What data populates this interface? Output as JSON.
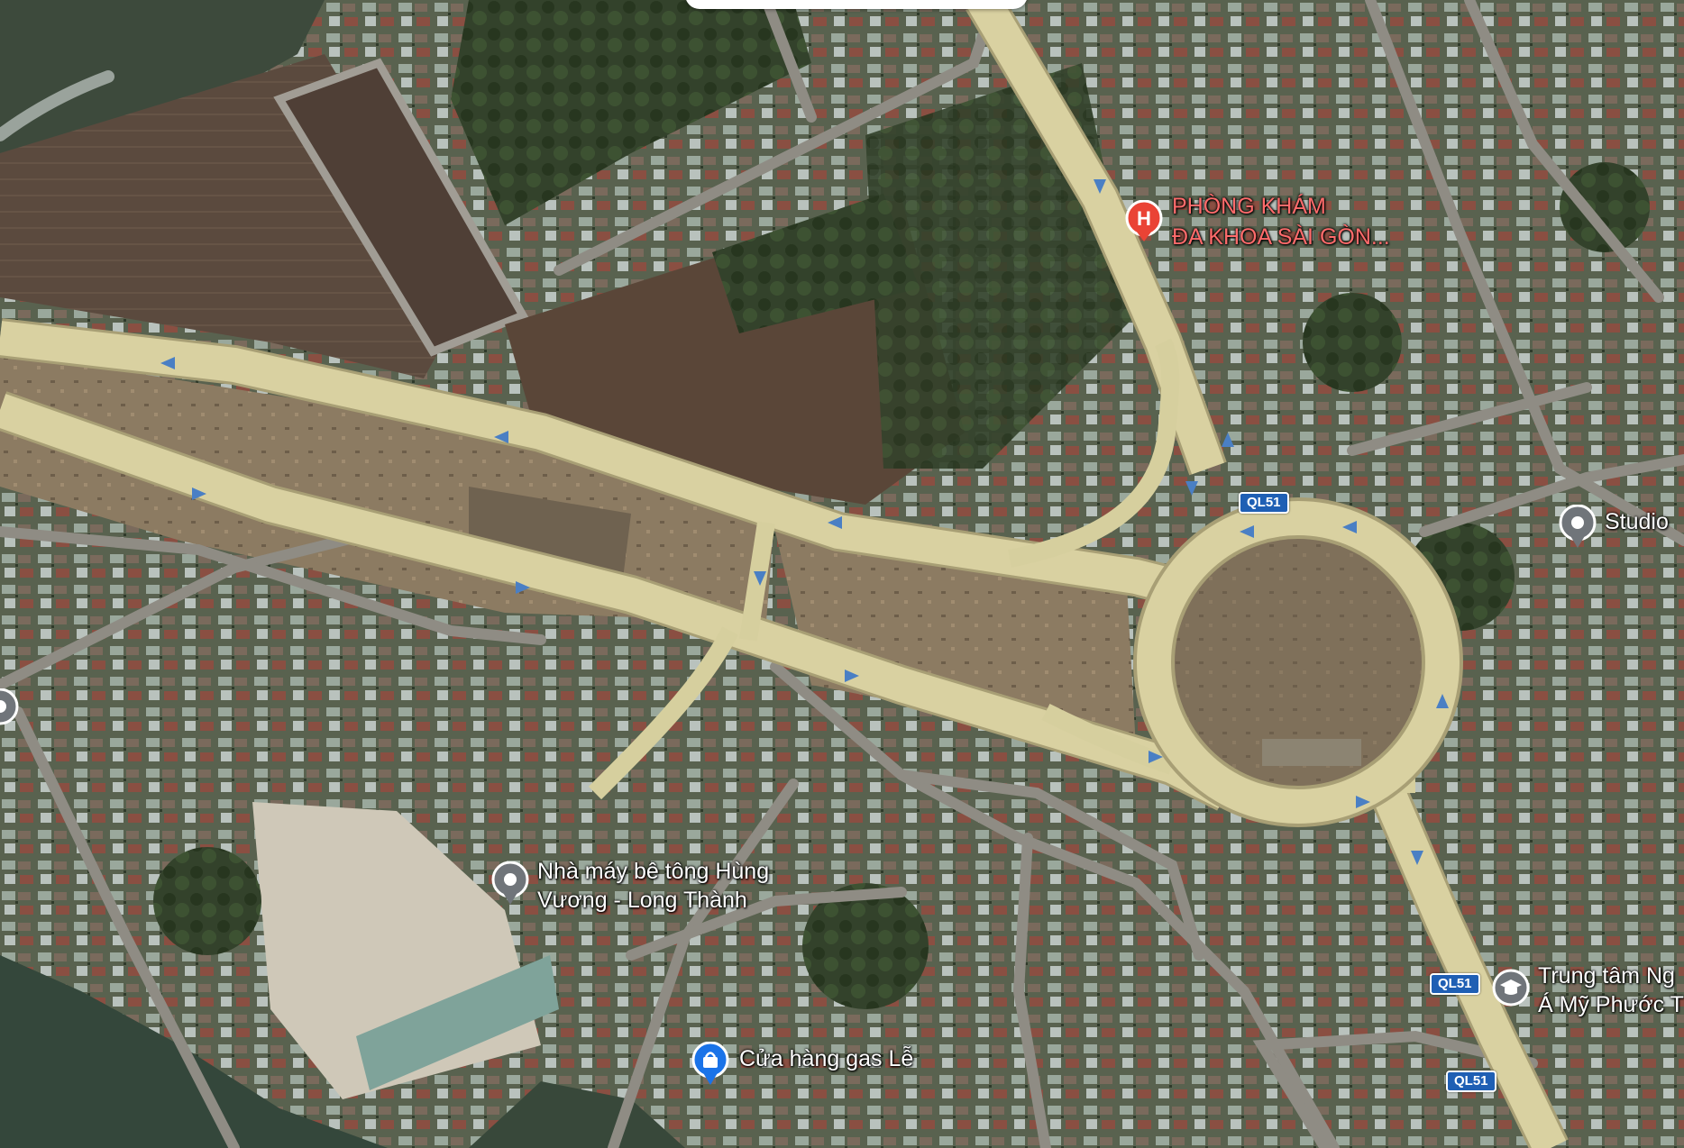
{
  "map": {
    "type": "satellite",
    "colors": {
      "road": "#d9d1a1",
      "road_edge": "#a89f75",
      "arrow": "#4a7fc4",
      "poi_red": "#ea4335",
      "poi_grey": "#70757a",
      "poi_blue": "#1a73e8",
      "shield": "#1f5fb4"
    }
  },
  "pois": {
    "clinic": {
      "line1": "PHÒNG KHÁM",
      "line2": "ĐA KHOA SÀI GÒN...",
      "icon": "hospital-icon",
      "glyph": "H"
    },
    "studio": {
      "label": "Studio",
      "icon": "place-pin-icon"
    },
    "concrete": {
      "line1": "Nhà máy bê tông Hùng",
      "line2": "Vương - Long Thành",
      "icon": "place-pin-icon"
    },
    "gas": {
      "label": "Cửa hàng gas Lễ",
      "icon": "shopping-bag-icon"
    },
    "center": {
      "line1": "Trung tâm Ng",
      "line2": "Á Mỹ Phước T",
      "icon": "school-icon"
    }
  },
  "road_shields": [
    "QL51",
    "QL51",
    "QL51"
  ]
}
